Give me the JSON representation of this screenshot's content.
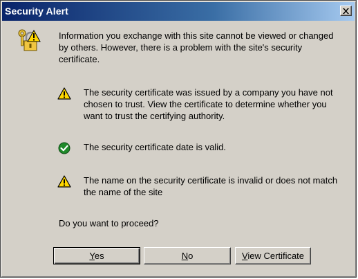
{
  "window": {
    "title": "Security Alert",
    "close_icon": "close-x-icon"
  },
  "intro": "Information you exchange with this site cannot be viewed or changed by others. However, there is a problem with the site's security certificate.",
  "items": [
    {
      "icon": "warning-icon",
      "text": "The security certificate was issued by a company you have not chosen to trust. View the certificate to determine whether you want to trust the certifying authority."
    },
    {
      "icon": "check-icon",
      "text": "The security certificate date is valid."
    },
    {
      "icon": "warning-icon",
      "text": "The name on the security certificate is invalid or does not match the name of the site"
    }
  ],
  "question": "Do you want to proceed?",
  "buttons": {
    "yes": {
      "mnemonic": "Y",
      "rest": "es"
    },
    "no": {
      "mnemonic": "N",
      "rest": "o"
    },
    "view": {
      "mnemonic": "V",
      "rest": "iew Certificate"
    }
  },
  "colors": {
    "titlebar_start": "#0a246a",
    "titlebar_end": "#a6caf0",
    "dialog_face": "#d4d0c8",
    "warning_yellow": "#ffd700",
    "check_green": "#1f8a2a"
  }
}
